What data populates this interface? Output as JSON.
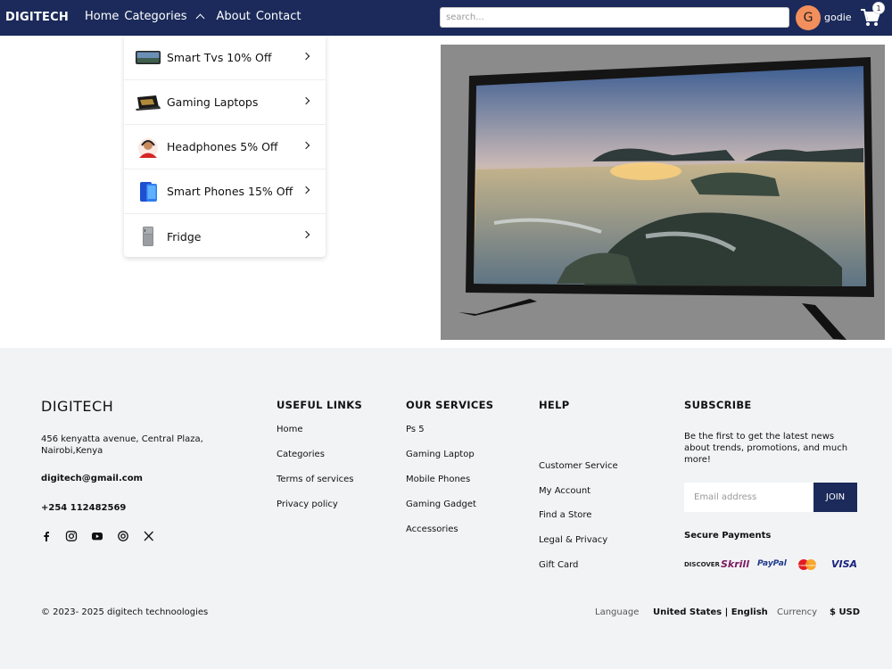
{
  "nav": {
    "logo": "DIGITECH",
    "links": [
      "Home",
      "Categories",
      "About",
      "Contact"
    ],
    "search_placeholder": "search...",
    "avatar_initial": "G",
    "username": "godie",
    "cart_count": "1"
  },
  "dropdown": {
    "items": [
      {
        "label": "Smart Tvs  10% Off"
      },
      {
        "label": "Gaming Laptops"
      },
      {
        "label": "Headphones  5% Off"
      },
      {
        "label": "Smart Phones  15% Off"
      },
      {
        "label": "Fridge"
      }
    ]
  },
  "footer": {
    "brand": "DIGITECH",
    "address": "456 kenyatta avenue, Central Plaza, Nairobi,Kenya",
    "email": "digitech@gmail.com",
    "phone": "+254 112482569",
    "useful_links": {
      "title": "USEFUL LINKS",
      "items": [
        "Home",
        "Categories",
        "Terms of services",
        "Privacy policy"
      ]
    },
    "services": {
      "title": "OUR SERVICES",
      "items": [
        "Ps 5",
        "Gaming Laptop",
        "Mobile Phones",
        "Gaming Gadget",
        "Accessories"
      ]
    },
    "help": {
      "title": "HELP",
      "items": [
        "Customer Service",
        "My Account",
        "Find a Store",
        "Legal & Privacy",
        "Gift Card"
      ]
    },
    "subscribe": {
      "title": "SUBSCRIBE",
      "text": "Be the first to get the latest news about trends, promotions, and much more!",
      "email_placeholder": "Email address",
      "join_label": "JOIN",
      "secure_payments": "Secure Payments",
      "payment_logos": [
        "DISCOVER",
        "Skrill",
        "PayPal",
        "mastercard",
        "VISA"
      ]
    },
    "copyright": "© 2023- 2025 digitech technoologies",
    "language_label": "Language",
    "language_value": "United States | English",
    "currency_label": "Currency",
    "currency_value": "$ USD"
  },
  "colors": {
    "navbar": "#1b2a5a",
    "avatar": "#f28f5c",
    "footer_bg": "#f2f3f5"
  }
}
